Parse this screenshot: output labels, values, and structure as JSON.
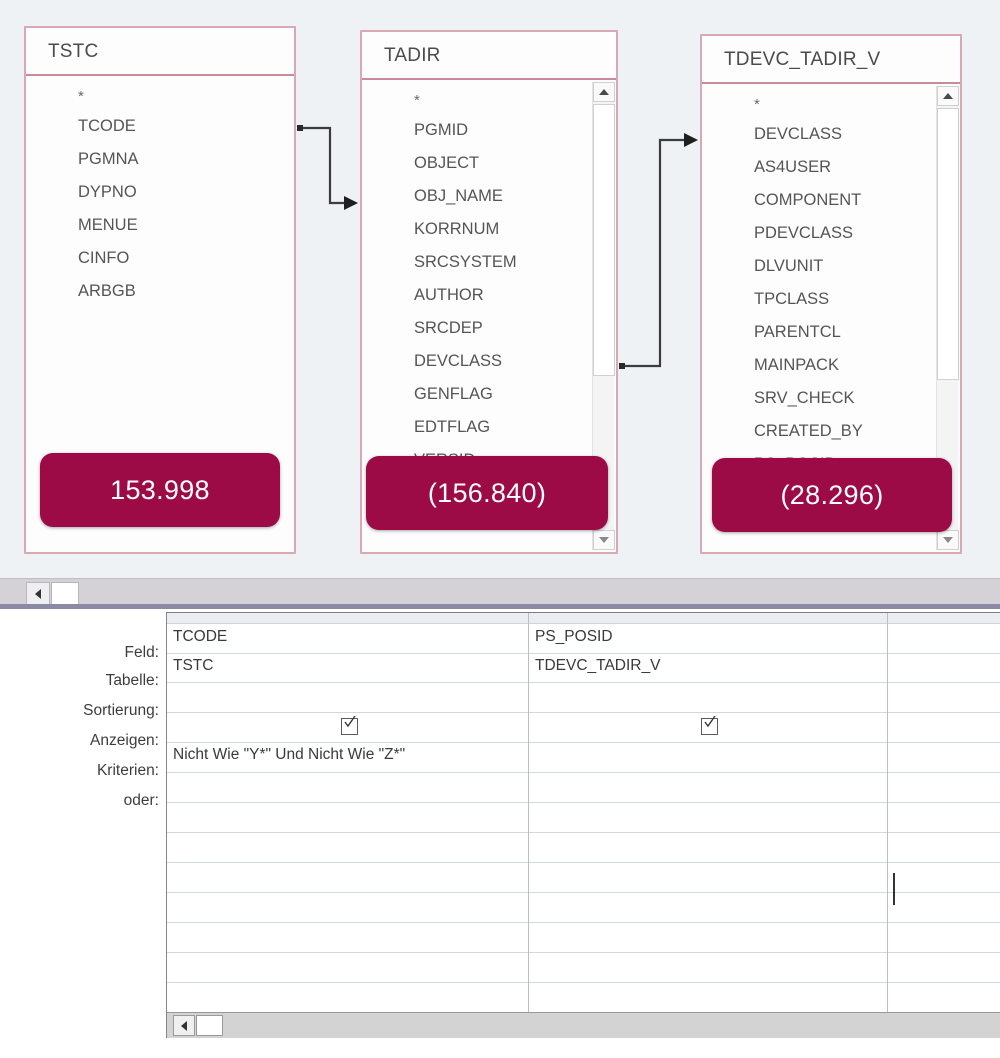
{
  "diagram": {
    "tables": [
      {
        "name": "TSTC",
        "fields": [
          "*",
          "TCODE",
          "PGMNA",
          "DYPNO",
          "MENUE",
          "CINFO",
          "ARBGB"
        ],
        "badge": "153.998",
        "has_scrollbar": false
      },
      {
        "name": "TADIR",
        "fields": [
          "*",
          "PGMID",
          "OBJECT",
          "OBJ_NAME",
          "KORRNUM",
          "SRCSYSTEM",
          "AUTHOR",
          "SRCDEP",
          "DEVCLASS",
          "GENFLAG",
          "EDTFLAG",
          "VERSID"
        ],
        "badge": "(156.840)",
        "has_scrollbar": true
      },
      {
        "name": "TDEVC_TADIR_V",
        "fields": [
          "*",
          "DEVCLASS",
          "AS4USER",
          "COMPONENT",
          "PDEVCLASS",
          "DLVUNIT",
          "TPCLASS",
          "PARENTCL",
          "MAINPACK",
          "SRV_CHECK",
          "CREATED_BY",
          "PS_POSID"
        ],
        "badge": "(28.296)",
        "has_scrollbar": true
      }
    ],
    "joins": [
      {
        "from_table": "TSTC",
        "to_table": "TADIR"
      },
      {
        "from_table": "TADIR",
        "to_table": "TDEVC_TADIR_V"
      }
    ],
    "accent_color": "#9c0b46",
    "border_color": "#d8a8b4",
    "background_color": "#eef2f5"
  },
  "grid": {
    "row_labels": [
      "Feld:",
      "Tabelle:",
      "Sortierung:",
      "Anzeigen:",
      "Kriterien:",
      "oder:"
    ],
    "columns": [
      {
        "field": "TCODE",
        "table": "TSTC",
        "sort": "",
        "show": true,
        "criteria": "Nicht Wie \"Y*\" Und Nicht Wie \"Z*\"",
        "or": ""
      },
      {
        "field": "PS_POSID",
        "table": "TDEVC_TADIR_V",
        "sort": "",
        "show": true,
        "criteria": "",
        "or": ""
      },
      {
        "field": "",
        "table": "",
        "sort": "",
        "show": false,
        "criteria": "",
        "or": ""
      }
    ]
  }
}
